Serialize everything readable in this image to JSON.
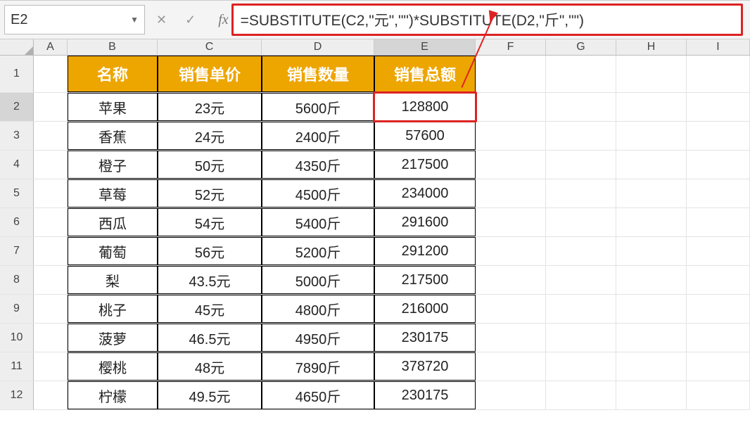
{
  "nameBox": "E2",
  "formula": "=SUBSTITUTE(C2,\"元\",\"\")*SUBSTITUTE(D2,\"斤\",\"\")",
  "columns": [
    "A",
    "B",
    "C",
    "D",
    "E",
    "F",
    "G",
    "H",
    "I"
  ],
  "rowNumbers": [
    1,
    2,
    3,
    4,
    5,
    6,
    7,
    8,
    9,
    10,
    11,
    12
  ],
  "header": {
    "b": "名称",
    "c": "销售单价",
    "d": "销售数量",
    "e": "销售总额"
  },
  "rows": [
    {
      "b": "苹果",
      "c": "23元",
      "d": "5600斤",
      "e": "128800"
    },
    {
      "b": "香蕉",
      "c": "24元",
      "d": "2400斤",
      "e": "57600"
    },
    {
      "b": "橙子",
      "c": "50元",
      "d": "4350斤",
      "e": "217500"
    },
    {
      "b": "草莓",
      "c": "52元",
      "d": "4500斤",
      "e": "234000"
    },
    {
      "b": "西瓜",
      "c": "54元",
      "d": "5400斤",
      "e": "291600"
    },
    {
      "b": "葡萄",
      "c": "56元",
      "d": "5200斤",
      "e": "291200"
    },
    {
      "b": "梨",
      "c": "43.5元",
      "d": "5000斤",
      "e": "217500"
    },
    {
      "b": "桃子",
      "c": "45元",
      "d": "4800斤",
      "e": "216000"
    },
    {
      "b": "菠萝",
      "c": "46.5元",
      "d": "4950斤",
      "e": "230175"
    },
    {
      "b": "樱桃",
      "c": "48元",
      "d": "7890斤",
      "e": "378720"
    },
    {
      "b": "柠檬",
      "c": "49.5元",
      "d": "4650斤",
      "e": "230175"
    }
  ]
}
